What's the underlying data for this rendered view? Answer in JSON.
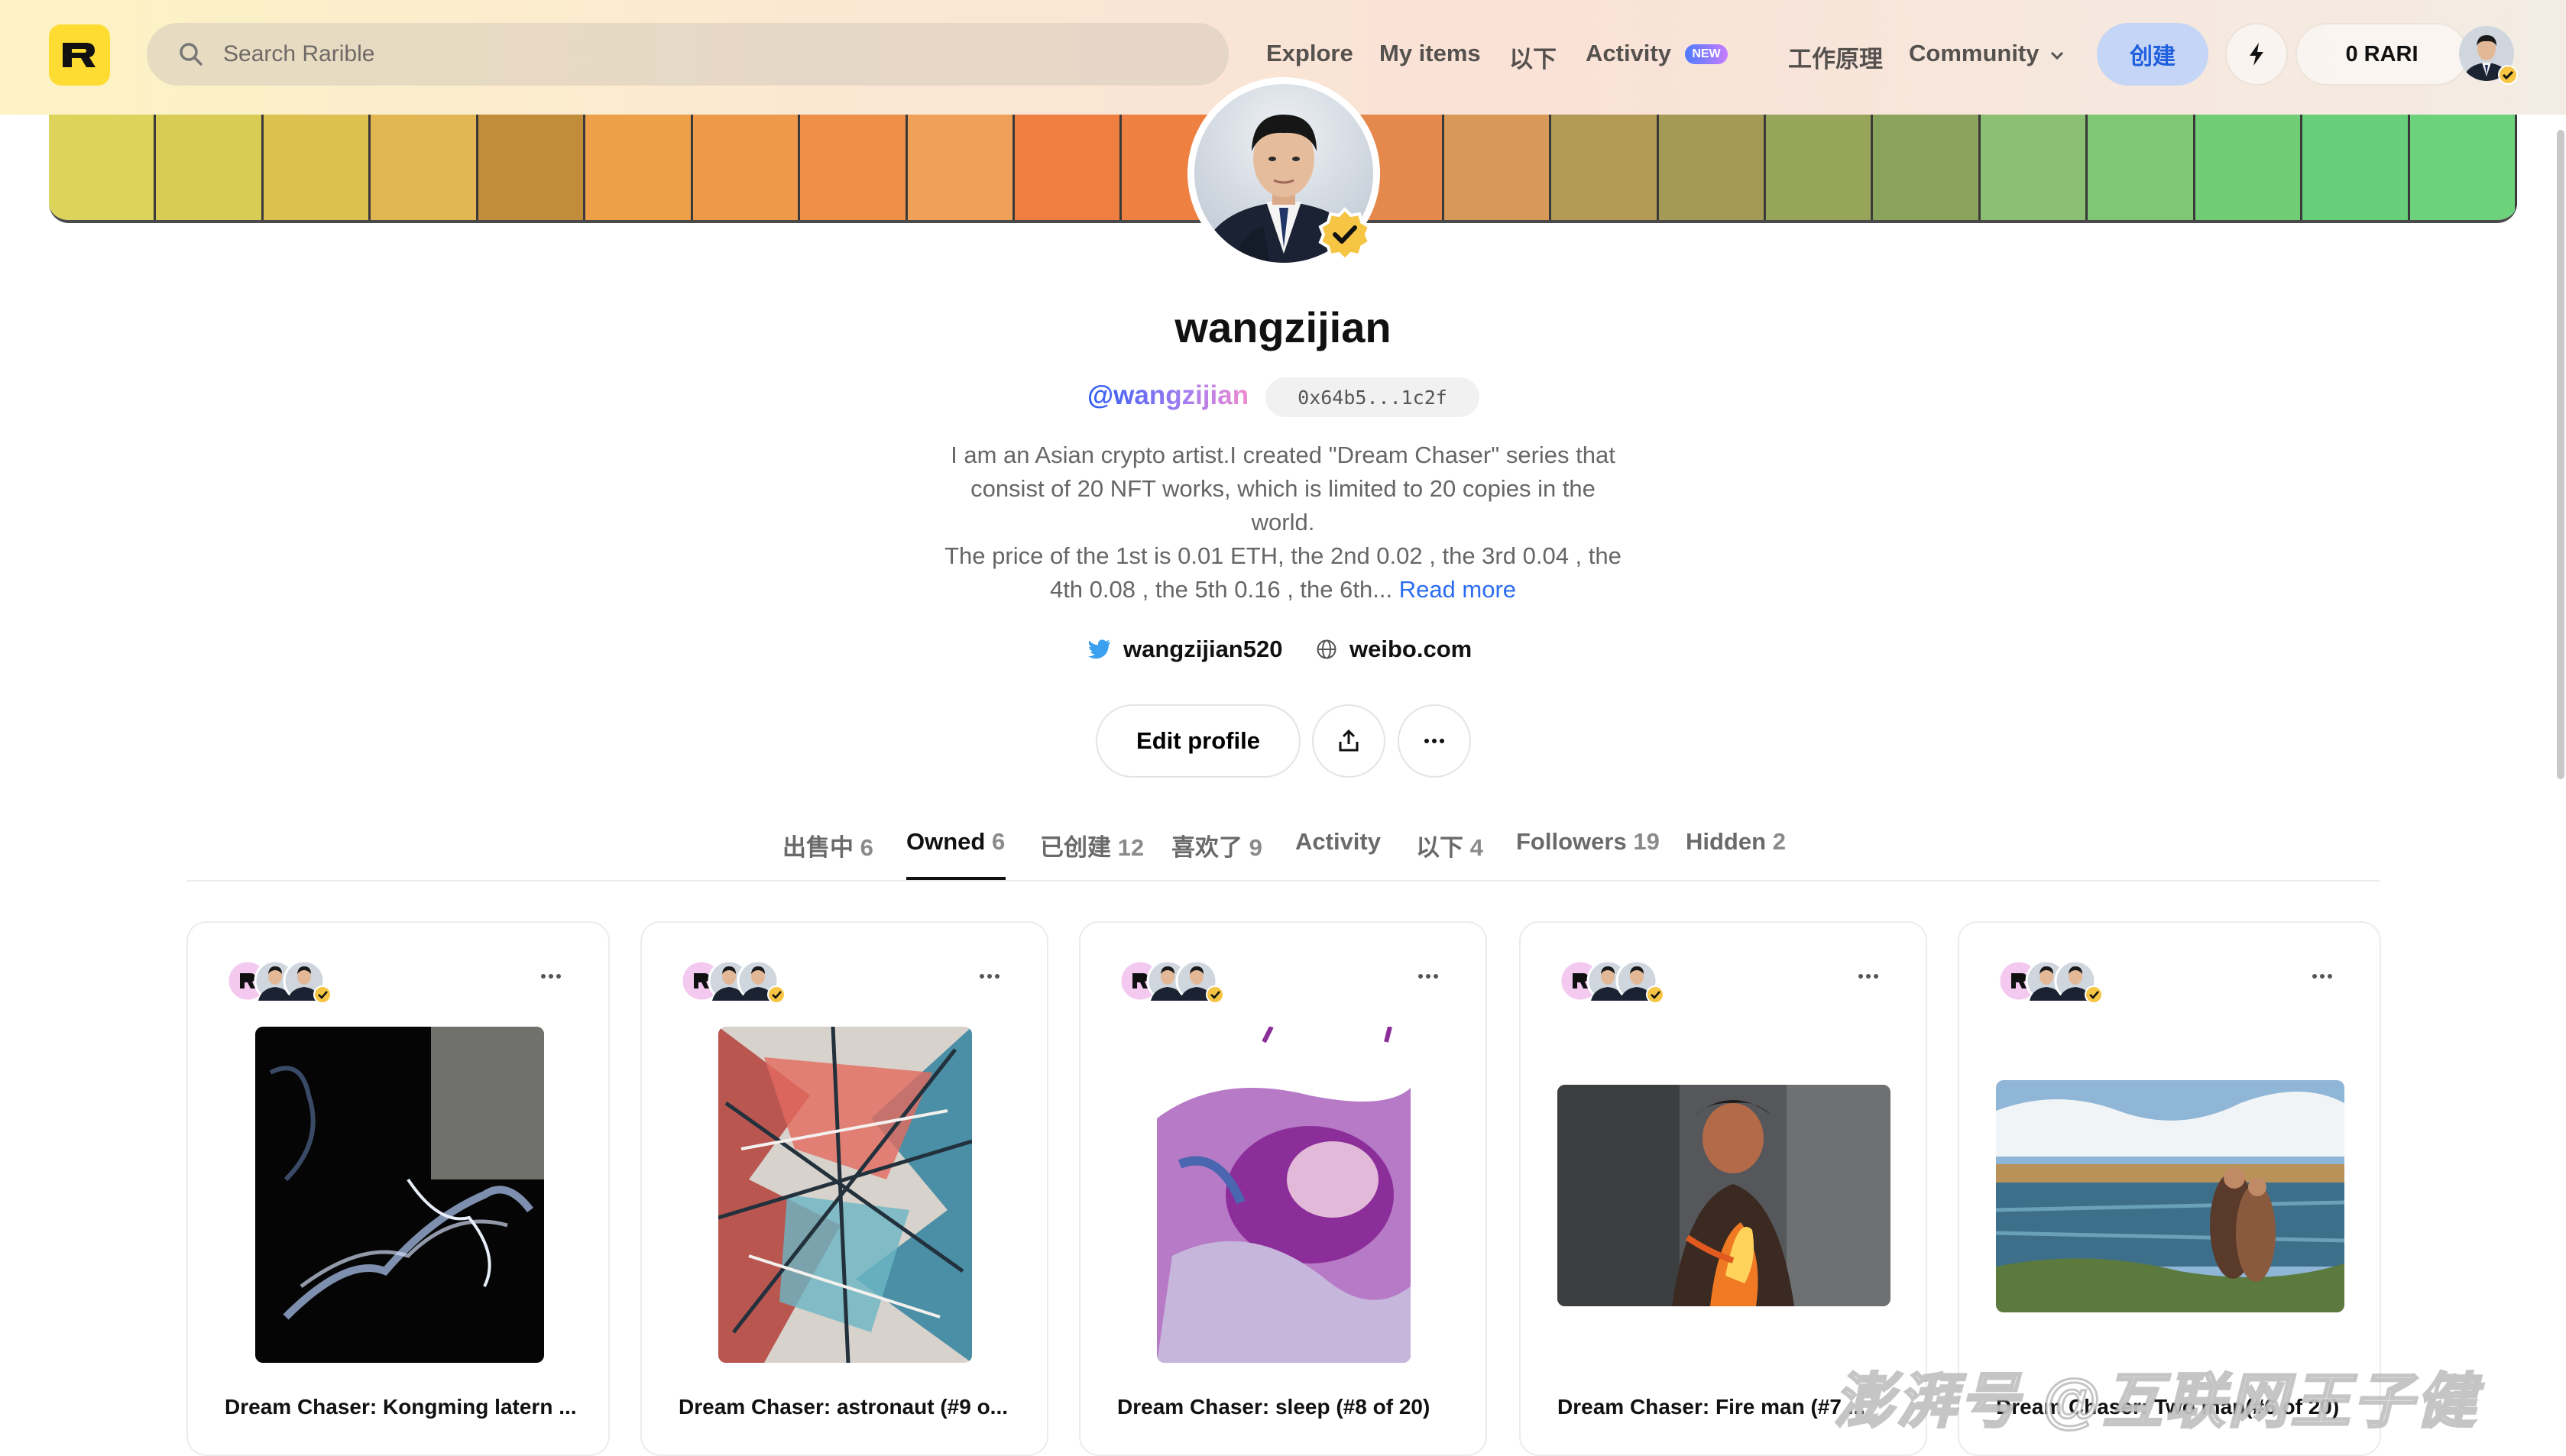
{
  "header": {
    "logo_letter": "R",
    "search_placeholder": "Search Rarible",
    "nav": {
      "explore": "Explore",
      "my_items": "My items",
      "following": "以下",
      "activity": "Activity",
      "activity_badge": "NEW",
      "how_it_works": "工作原理",
      "community": "Community"
    },
    "create": "创建",
    "balance": "0 RARI"
  },
  "banner": {
    "colors": [
      "#dcd35a",
      "#d9cc55",
      "#ddc150",
      "#e2b652",
      "#c28d3a",
      "#eda047",
      "#ec9a4a",
      "#ee9047",
      "#efa15a",
      "#ef7f40",
      "#ee8042",
      "#ec7a3c",
      "#e5884c",
      "#d89958",
      "#b39a55",
      "#a49a55",
      "#97a55a",
      "#8aa35c",
      "#8bbf72",
      "#7ec873",
      "#71cc76",
      "#67cf79",
      "#6dd27c"
    ]
  },
  "profile": {
    "name": "wangzijian",
    "handle": "@wangzijian",
    "address": "0x64b5...1c2f",
    "bio_lines": [
      "I am an Asian crypto artist.I created \"Dream Chaser\" series that",
      "consist of 20 NFT works, which is limited to 20 copies in the",
      "world.",
      "The price of the 1st is 0.01 ETH, the 2nd 0.02 , the 3rd 0.04 , the",
      "4th 0.08 , the 5th 0.16 , the 6th..."
    ],
    "read_more": "Read more",
    "twitter": "wangzijian520",
    "website": "weibo.com",
    "edit_profile": "Edit profile"
  },
  "tabs": [
    {
      "label": "出售中",
      "count": "6"
    },
    {
      "label": "Owned",
      "count": "6"
    },
    {
      "label": "已创建",
      "count": "12"
    },
    {
      "label": "喜欢了",
      "count": "9"
    },
    {
      "label": "Activity",
      "count": ""
    },
    {
      "label": "以下",
      "count": "4"
    },
    {
      "label": "Followers",
      "count": "19"
    },
    {
      "label": "Hidden",
      "count": "2"
    }
  ],
  "active_tab": "Owned",
  "cards": [
    {
      "title": "Dream Chaser: Kongming latern ..."
    },
    {
      "title": "Dream Chaser: astronaut (#9 o..."
    },
    {
      "title": "Dream Chaser: sleep (#8 of 20)"
    },
    {
      "title": "Dream Chaser: Fire man (#7 ..."
    },
    {
      "title": "Dream Chaser: Two man(#6 of 20)"
    }
  ],
  "watermark": "澎湃号 @互联网王子健",
  "colors": {
    "brand_yellow": "#fedc32",
    "link_blue": "#2b6cf0",
    "verified_gold": "#f6c544"
  }
}
